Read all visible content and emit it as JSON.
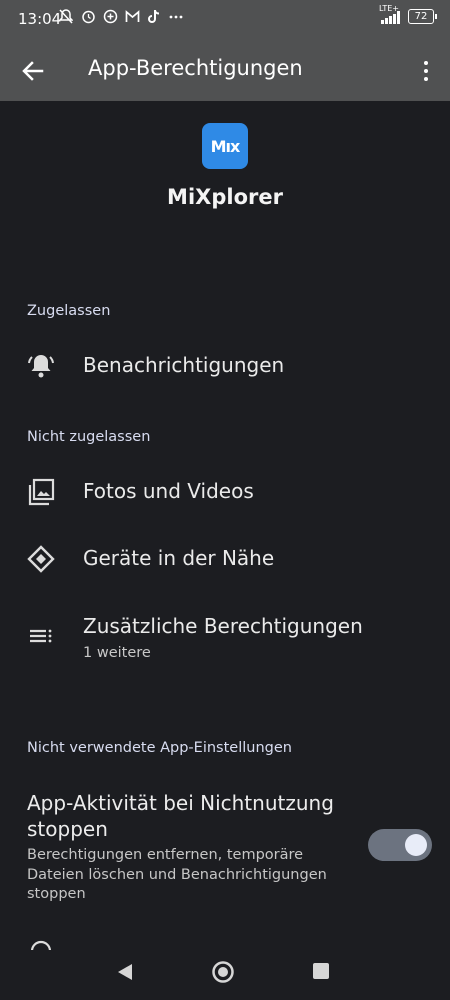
{
  "status_bar": {
    "time": "13:04",
    "network": "LTE+",
    "battery": "72",
    "icons": [
      "mute-icon",
      "alarm-icon",
      "plus-icon",
      "gmail-icon",
      "tiktok-icon",
      "more-notifications-icon"
    ]
  },
  "app_bar": {
    "title": "App-Berechtigungen"
  },
  "app": {
    "name": "MiXplorer",
    "icon_text": "Mıx",
    "icon_color": "#2f8ae6"
  },
  "sections": {
    "allowed": "Zugelassen",
    "not_allowed": "Nicht zugelassen",
    "unused": "Nicht verwendete App-Einstellungen"
  },
  "permissions": {
    "notifications": "Benachrichtigungen",
    "photos": "Fotos und Videos",
    "nearby": "Geräte in der Nähe",
    "additional": "Zusätzliche Berechtigungen",
    "additional_sub": "1 weitere"
  },
  "unused_setting": {
    "title": "App-Aktivität bei Nichtnutzung stoppen",
    "description": "Berechtigungen entfernen, temporäre Dateien löschen und Benachrichtigungen stoppen",
    "enabled": true
  }
}
